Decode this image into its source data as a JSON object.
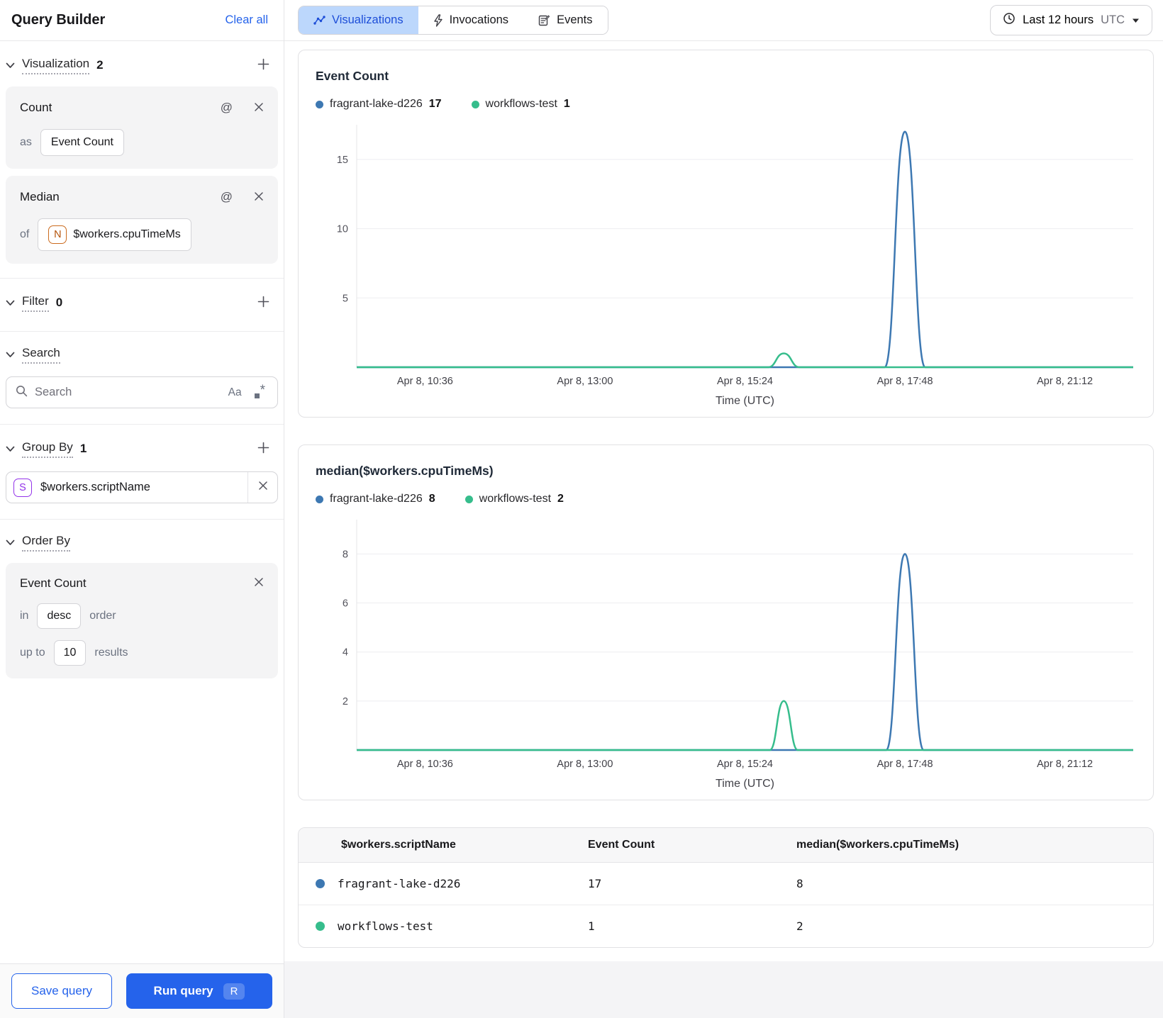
{
  "sidebar": {
    "title": "Query Builder",
    "clear_all": "Clear all",
    "sections": {
      "visualization": {
        "label": "Visualization",
        "count": "2"
      },
      "filter": {
        "label": "Filter",
        "count": "0"
      },
      "search": {
        "label": "Search",
        "placeholder": "Search",
        "case_toggle": "Aa"
      },
      "group_by": {
        "label": "Group By",
        "count": "1",
        "field": "$workers.scriptName",
        "field_type_letter": "S"
      },
      "order_by": {
        "label": "Order By",
        "item_title": "Event Count",
        "in_label": "in",
        "direction": "desc",
        "order_label": "order",
        "up_to_label": "up to",
        "limit": "10",
        "results_label": "results"
      }
    },
    "viz_cards": [
      {
        "title": "Count",
        "prefix": "as",
        "value": "Event Count"
      },
      {
        "title": "Median",
        "prefix": "of",
        "value": "$workers.cpuTimeMs",
        "value_type_letter": "N"
      }
    ],
    "footer": {
      "save": "Save query",
      "run": "Run query",
      "run_shortcut": "R"
    }
  },
  "header": {
    "tabs": [
      {
        "label": "Visualizations",
        "icon": "chart-line-icon",
        "active": true
      },
      {
        "label": "Invocations",
        "icon": "bolt-icon",
        "active": false
      },
      {
        "label": "Events",
        "icon": "memo-icon",
        "active": false
      }
    ],
    "time_range": {
      "label": "Last 12 hours",
      "timezone": "UTC"
    }
  },
  "colors": {
    "series_blue": "#3d78b2",
    "series_green": "#36bd8c",
    "accent_blue": "#2563eb",
    "tab_active_bg": "#bcd7fc",
    "tab_active_text": "#1d4ed8"
  },
  "chart_data": [
    {
      "type": "line",
      "title": "Event Count",
      "xlabel": "Time (UTC)",
      "ylim": [
        0,
        17.5
      ],
      "yticks": [
        5,
        10,
        15
      ],
      "grid": true,
      "legend_position": "top",
      "x_ticks": [
        {
          "label": "Apr 8, 10:36",
          "f": 0.088
        },
        {
          "label": "Apr 8, 13:00",
          "f": 0.294
        },
        {
          "label": "Apr 8, 15:24",
          "f": 0.5
        },
        {
          "label": "Apr 8, 17:48",
          "f": 0.706
        },
        {
          "label": "Apr 8, 21:12",
          "f": 0.912
        }
      ],
      "legend": [
        {
          "name": "fragrant-lake-d226",
          "value": "17",
          "color": "#3d78b2"
        },
        {
          "name": "workflows-test",
          "value": "1",
          "color": "#36bd8c"
        }
      ],
      "series": [
        {
          "name": "fragrant-lake-d226",
          "color": "#3d78b2",
          "baseline": 0,
          "spikes": [
            {
              "x_f": 0.706,
              "peak": 17,
              "half_width_f": 0.026
            }
          ]
        },
        {
          "name": "workflows-test",
          "color": "#36bd8c",
          "baseline": 0,
          "spikes": [
            {
              "x_f": 0.55,
              "peak": 1,
              "half_width_f": 0.02
            }
          ]
        }
      ]
    },
    {
      "type": "line",
      "title": "median($workers.cpuTimeMs)",
      "xlabel": "Time (UTC)",
      "ylim": [
        0,
        9.4
      ],
      "yticks": [
        2,
        4,
        6,
        8
      ],
      "grid": true,
      "legend_position": "top",
      "x_ticks": [
        {
          "label": "Apr 8, 10:36",
          "f": 0.088
        },
        {
          "label": "Apr 8, 13:00",
          "f": 0.294
        },
        {
          "label": "Apr 8, 15:24",
          "f": 0.5
        },
        {
          "label": "Apr 8, 17:48",
          "f": 0.706
        },
        {
          "label": "Apr 8, 21:12",
          "f": 0.912
        }
      ],
      "legend": [
        {
          "name": "fragrant-lake-d226",
          "value": "8",
          "color": "#3d78b2"
        },
        {
          "name": "workflows-test",
          "value": "2",
          "color": "#36bd8c"
        }
      ],
      "series": [
        {
          "name": "fragrant-lake-d226",
          "color": "#3d78b2",
          "baseline": 0,
          "spikes": [
            {
              "x_f": 0.706,
              "peak": 8,
              "half_width_f": 0.024
            }
          ]
        },
        {
          "name": "workflows-test",
          "color": "#36bd8c",
          "baseline": 0,
          "spikes": [
            {
              "x_f": 0.55,
              "peak": 2,
              "half_width_f": 0.018
            }
          ]
        }
      ]
    }
  ],
  "table": {
    "columns": [
      "$workers.scriptName",
      "Event Count",
      "median($workers.cpuTimeMs)"
    ],
    "rows": [
      {
        "color": "#3d78b2",
        "name": "fragrant-lake-d226",
        "event_count": "17",
        "median": "8"
      },
      {
        "color": "#36bd8c",
        "name": "workflows-test",
        "event_count": "1",
        "median": "2"
      }
    ]
  }
}
